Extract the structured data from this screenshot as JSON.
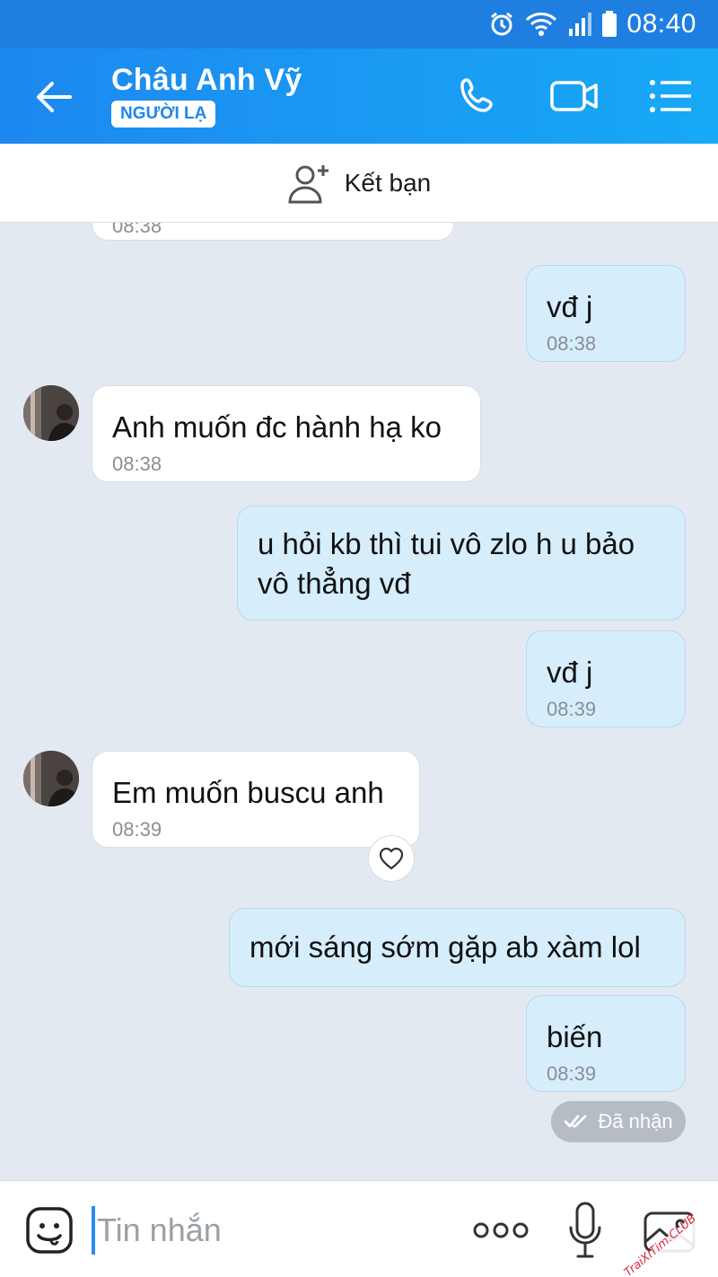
{
  "status_bar": {
    "time": "08:40"
  },
  "header": {
    "contact_name": "Châu Anh Vỹ",
    "badge": "NGƯỜI LẠ"
  },
  "add_friend": {
    "label": "Kết bạn"
  },
  "messages": [
    {
      "dir": "in",
      "text": "",
      "time": "08:38"
    },
    {
      "dir": "out",
      "text": "vđ j",
      "time": "08:38"
    },
    {
      "dir": "in",
      "text": "Anh muốn đc hành hạ ko",
      "time": "08:38"
    },
    {
      "dir": "out",
      "text": "u hỏi kb thì tui vô zlo h u bảo\nvô thẳng vđ",
      "time": ""
    },
    {
      "dir": "out",
      "text": "vđ j",
      "time": "08:39"
    },
    {
      "dir": "in",
      "text": "Em muốn buscu anh",
      "time": "08:39"
    },
    {
      "dir": "out",
      "text": "mới sáng sớm gặp ab xàm lol",
      "time": ""
    },
    {
      "dir": "out",
      "text": "biến",
      "time": "08:39"
    }
  ],
  "delivery_status": "Đã nhận",
  "input": {
    "placeholder": "Tin nhắn"
  },
  "watermark": "TraiXiTim.CLUB",
  "colors": {
    "header_start": "#1d88f0",
    "header_end": "#17a9f6",
    "out_bubble": "#d6edfc",
    "accent": "#2a8ef0"
  }
}
